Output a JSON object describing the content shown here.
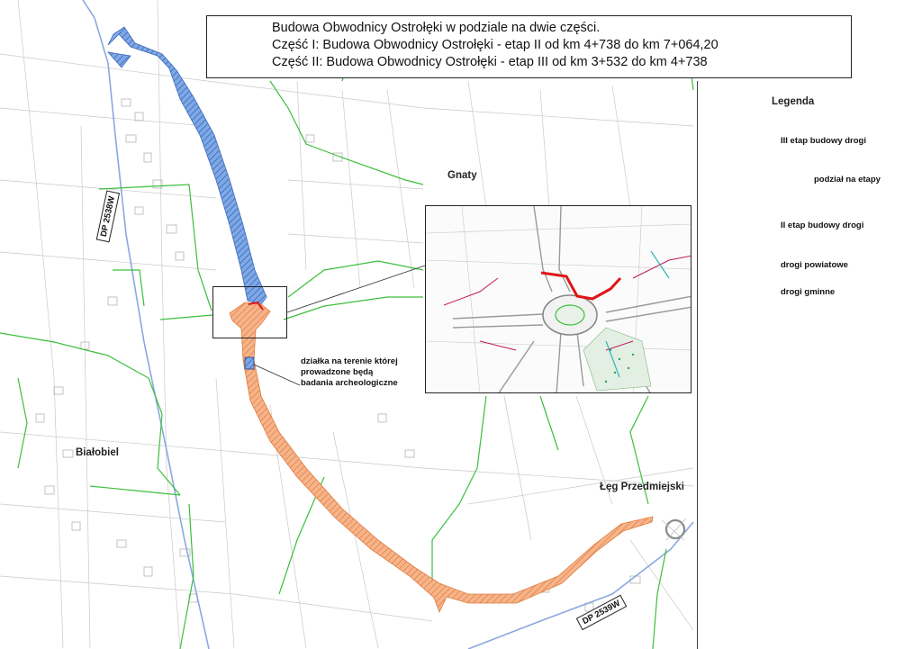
{
  "title": {
    "line1": "Budowa Obwodnicy Ostrołęki w podziale na dwie części.",
    "line2": "Część I: Budowa Obwodnicy Ostrołęki - etap II od km 4+738 do km 7+064,20",
    "line3": "Część II: Budowa Obwodnicy Ostrołęki  - etap III od km 3+532 do km 4+738"
  },
  "legend": {
    "title": "Legenda",
    "items": [
      {
        "label": "III etap budowy drogi",
        "color": "#5b8fd6"
      },
      {
        "label": "podział na etapy",
        "color": "#e01515"
      },
      {
        "label": "II etap budowy drogi",
        "color": "#f0a070"
      },
      {
        "label": "drogi powiatowe",
        "color": "#8aa8e0"
      },
      {
        "label": "drogi gminne",
        "color": "#3cbf3c"
      }
    ]
  },
  "places": {
    "gnaty": "Gnaty",
    "bialobiel": "Białobiel",
    "leg": "Łęg Przedmiejski"
  },
  "note": {
    "line1": "działka na terenie której",
    "line2": "prowadzone będą",
    "line3": "badania archeologiczne"
  },
  "roads": {
    "dp2538": "DP 2538W",
    "dp2539": "DP 2539W"
  }
}
